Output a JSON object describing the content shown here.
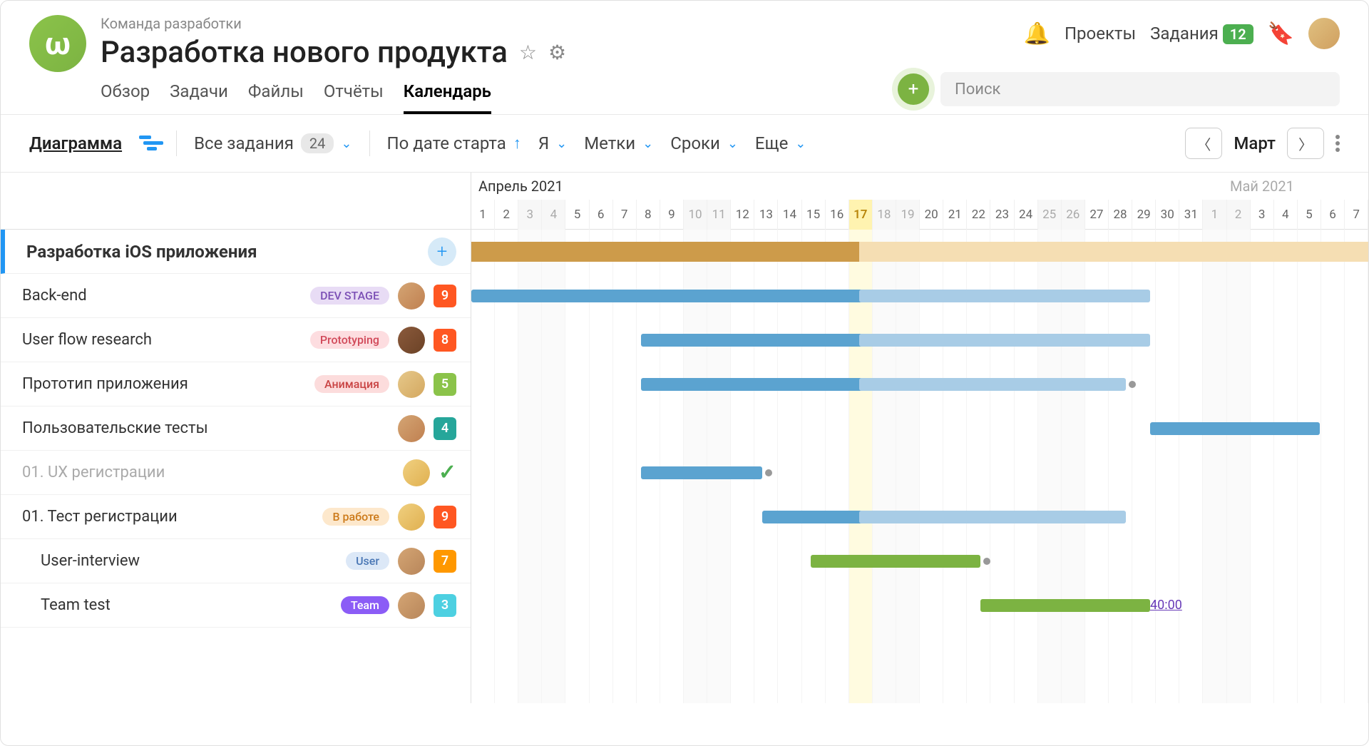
{
  "header": {
    "breadcrumb": "Команда разработки",
    "title": "Разработка нового продукта",
    "nav_projects": "Проекты",
    "nav_tasks": "Задания",
    "tasks_badge": "12",
    "search_placeholder": "Поиск"
  },
  "tabs": [
    {
      "label": "Обзор",
      "active": false
    },
    {
      "label": "Задачи",
      "active": false
    },
    {
      "label": "Файлы",
      "active": false
    },
    {
      "label": "Отчёты",
      "active": false
    },
    {
      "label": "Календарь",
      "active": true
    }
  ],
  "toolbar": {
    "diagram": "Диаграмма",
    "all_tasks": "Все задания",
    "all_tasks_count": "24",
    "by_start": "По дате старта",
    "me": "Я",
    "labels": "Метки",
    "deadlines": "Сроки",
    "more": "Еще",
    "month": "Март"
  },
  "timeline": {
    "month_a": "Апрель 2021",
    "month_b": "Май 2021",
    "days": [
      {
        "n": "1",
        "w": false
      },
      {
        "n": "2",
        "w": false
      },
      {
        "n": "3",
        "w": true
      },
      {
        "n": "4",
        "w": true
      },
      {
        "n": "5",
        "w": false
      },
      {
        "n": "6",
        "w": false
      },
      {
        "n": "7",
        "w": false
      },
      {
        "n": "8",
        "w": false
      },
      {
        "n": "9",
        "w": false
      },
      {
        "n": "10",
        "w": true
      },
      {
        "n": "11",
        "w": true
      },
      {
        "n": "12",
        "w": false
      },
      {
        "n": "13",
        "w": false
      },
      {
        "n": "14",
        "w": false
      },
      {
        "n": "15",
        "w": false
      },
      {
        "n": "16",
        "w": false
      },
      {
        "n": "17",
        "w": false,
        "today": true
      },
      {
        "n": "18",
        "w": true
      },
      {
        "n": "19",
        "w": true
      },
      {
        "n": "20",
        "w": false
      },
      {
        "n": "21",
        "w": false
      },
      {
        "n": "22",
        "w": false
      },
      {
        "n": "23",
        "w": false
      },
      {
        "n": "24",
        "w": false
      },
      {
        "n": "25",
        "w": true
      },
      {
        "n": "26",
        "w": true
      },
      {
        "n": "27",
        "w": false
      },
      {
        "n": "28",
        "w": false
      },
      {
        "n": "29",
        "w": false
      },
      {
        "n": "30",
        "w": false
      },
      {
        "n": "31",
        "w": false
      },
      {
        "n": "1",
        "w": true
      },
      {
        "n": "2",
        "w": true
      },
      {
        "n": "3",
        "w": false
      },
      {
        "n": "4",
        "w": false
      },
      {
        "n": "5",
        "w": false
      },
      {
        "n": "6",
        "w": false
      },
      {
        "n": "7",
        "w": false
      }
    ]
  },
  "tasks": [
    {
      "name": "Разработка iOS приложения",
      "group": true
    },
    {
      "name": "Back-end",
      "tag": "DEV STAGE",
      "tag_cls": "tag-purple",
      "count": "9",
      "count_cls": "cb-red",
      "avatar": "a1"
    },
    {
      "name": "User flow research",
      "tag": "Prototyping",
      "tag_cls": "tag-pink",
      "count": "8",
      "count_cls": "cb-orange",
      "avatar": "a2"
    },
    {
      "name": "Прототип приложения",
      "tag": "Анимация",
      "tag_cls": "tag-red",
      "count": "5",
      "count_cls": "cb-lime",
      "avatar": "a3"
    },
    {
      "name": "Пользовательские тесты",
      "count": "4",
      "count_cls": "cb-teal",
      "avatar": "a1"
    },
    {
      "name": "01. UX регистрации",
      "done": true,
      "check": true,
      "avatar": "a4"
    },
    {
      "name": "01. Тест регистрации",
      "tag": "В работе",
      "tag_cls": "tag-orange",
      "count": "9",
      "count_cls": "cb-red",
      "avatar": "a4"
    },
    {
      "name": "User-interview",
      "tag": "User",
      "tag_cls": "tag-blue",
      "count": "7",
      "count_cls": "cb-amber",
      "indent": true,
      "avatar": "a5"
    },
    {
      "name": "Team test",
      "tag": "Team",
      "tag_cls": "tag-violet",
      "count": "3",
      "count_cls": "cb-cyan",
      "indent": true,
      "avatar": "a5"
    }
  ],
  "bars": {
    "group_fill_end_day": 17,
    "rows": [
      {
        "type": "group"
      },
      {
        "segments": [
          {
            "start": 1,
            "end": 17,
            "cls": "bar-blue"
          },
          {
            "start": 17,
            "end": 28,
            "cls": "bar-blue-light"
          }
        ]
      },
      {
        "segments": [
          {
            "start": 8,
            "end": 17,
            "cls": "bar-blue"
          },
          {
            "start": 17,
            "end": 28,
            "cls": "bar-blue-light"
          }
        ]
      },
      {
        "segments": [
          {
            "start": 8,
            "end": 17,
            "cls": "bar-blue"
          },
          {
            "start": 17,
            "end": 27,
            "cls": "bar-blue-light"
          }
        ],
        "dep_end": 27
      },
      {
        "segments": [
          {
            "start": 29,
            "end": 35,
            "cls": "bar-blue"
          }
        ],
        "dep_from_prev": true
      },
      {
        "segments": [
          {
            "start": 8,
            "end": 12,
            "cls": "bar-blue"
          }
        ],
        "dep_end": 12
      },
      {
        "segments": [
          {
            "start": 13,
            "end": 17,
            "cls": "bar-blue"
          },
          {
            "start": 17,
            "end": 27,
            "cls": "bar-blue-light"
          }
        ]
      },
      {
        "segments": [
          {
            "start": 15,
            "end": 21,
            "cls": "bar-green"
          }
        ],
        "dep_end": 21
      },
      {
        "segments": [
          {
            "start": 22,
            "end": 28,
            "cls": "bar-green"
          }
        ],
        "time": "40:00",
        "time_day": 29
      }
    ]
  }
}
